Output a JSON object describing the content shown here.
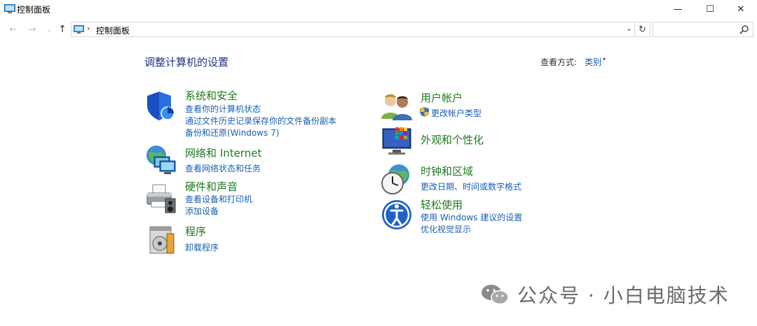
{
  "window": {
    "title": "控制面板",
    "minimize_glyph": "—",
    "maximize_glyph": "☐",
    "close_glyph": "✕"
  },
  "address": {
    "back_glyph": "←",
    "forward_glyph": "→",
    "history_glyph": "⌄",
    "up_glyph": "↑",
    "separator": "›",
    "path": "控制面板",
    "dropdown_glyph": "⌄",
    "refresh_glyph": "↻",
    "search_placeholder": ""
  },
  "header": {
    "title": "调整计算机的设置",
    "view_by_label": "查看方式:",
    "view_by_value": "类别",
    "view_by_dropdown_glyph": "▾"
  },
  "categories": {
    "security": {
      "title": "系统和安全",
      "links": [
        "查看你的计算机状态",
        "通过文件历史记录保存你的文件备份副本",
        "备份和还原(Windows 7)"
      ]
    },
    "network": {
      "title": "网络和 Internet",
      "links": [
        "查看网络状态和任务"
      ]
    },
    "hardware": {
      "title": "硬件和声音",
      "links": [
        "查看设备和打印机",
        "添加设备"
      ]
    },
    "programs": {
      "title": "程序",
      "links": [
        "卸载程序"
      ]
    },
    "users": {
      "title": "用户帐户",
      "links": [
        "更改帐户类型"
      ]
    },
    "appearance": {
      "title": "外观和个性化",
      "links": []
    },
    "clock": {
      "title": "时钟和区域",
      "links": [
        "更改日期、时间或数字格式"
      ]
    },
    "ease": {
      "title": "轻松使用",
      "links": [
        "使用 Windows 建议的设置",
        "优化视觉显示"
      ]
    }
  },
  "watermark": {
    "text": "公众号 · 小白电脑技术"
  },
  "colors": {
    "title_blue": "#1e3287",
    "link_blue": "#1a5fb4",
    "category_green": "#1e7a1e"
  }
}
